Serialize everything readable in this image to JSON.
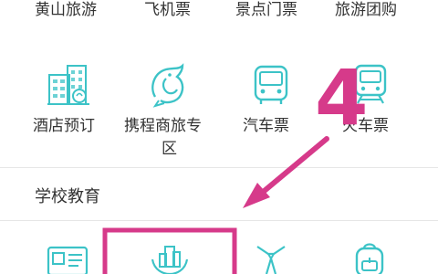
{
  "row1": [
    "黄山旅游",
    "飞机票",
    "景点门票",
    "旅游团购"
  ],
  "row2": {
    "hotel": "酒店预订",
    "trip_line1": "携程商旅专",
    "trip_line2": "区",
    "bus": "汽车票",
    "train": "火车票"
  },
  "section": {
    "title": "学校教育"
  },
  "annotation": {
    "step_number": "4"
  },
  "colors": {
    "icon": "#3cc3c7",
    "annotation": "#d63a8a",
    "divider": "#e6e6e6"
  },
  "icons": [
    "hotel-building-icon",
    "dolphin-icon",
    "bus-icon",
    "train-icon",
    "id-card-icon",
    "hands-building-icon",
    "necktie-icon",
    "backpack-icon"
  ]
}
